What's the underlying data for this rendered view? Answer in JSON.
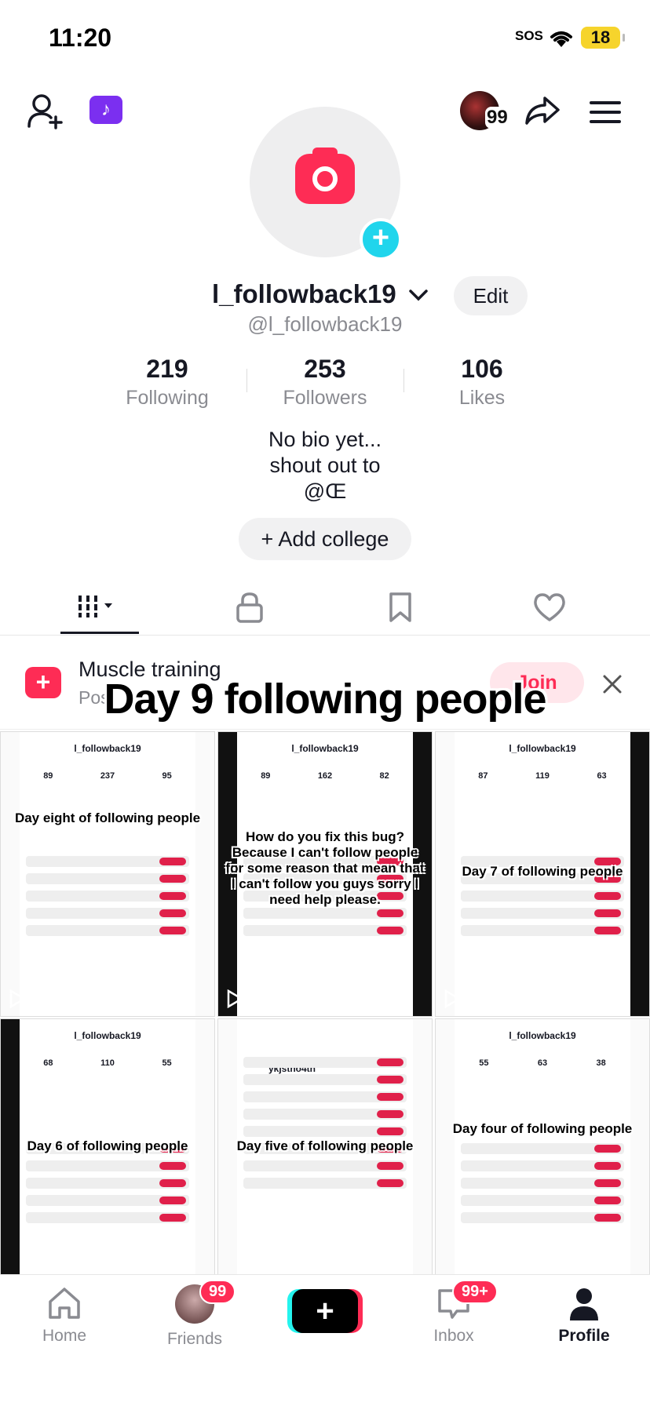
{
  "status": {
    "time": "11:20",
    "sos": "SOS",
    "battery": "18"
  },
  "header": {
    "avatar_count": "99",
    "music_icon": "tiktok-music-icon"
  },
  "profile": {
    "username": "l_followback19",
    "handle": "@l_followback19",
    "edit_label": "Edit",
    "stats": [
      {
        "num": "219",
        "label": "Following"
      },
      {
        "num": "253",
        "label": "Followers"
      },
      {
        "num": "106",
        "label": "Likes"
      }
    ],
    "bio_lines": [
      "No bio yet...",
      "shout out to",
      "@Œ"
    ],
    "add_college_label": "+ Add college"
  },
  "promo": {
    "title": "Muscle training",
    "subtitle": "Pos",
    "subtitle_tail": "s",
    "join_label": "Join",
    "overlay_caption": "Day 9 following people"
  },
  "grid": [
    {
      "caption": "Day eight of following people",
      "name": "l_followback19",
      "stats": [
        "89",
        "237",
        "95"
      ]
    },
    {
      "caption": "How do you fix this bug? Because I can't follow people for some reason that mean that I can't follow you guys sorry I need help please.",
      "name": "l_followback19",
      "stats": [
        "89",
        "162",
        "82"
      ]
    },
    {
      "caption": "Day 7 of following people",
      "name": "l_followback19",
      "stats": [
        "87",
        "119",
        "63"
      ]
    },
    {
      "caption": "Day 6 of following people",
      "name": "l_followback19",
      "stats": [
        "68",
        "110",
        "55"
      ]
    },
    {
      "caption": "Day five of following people",
      "name": "ykjstno4th",
      "stats": [
        "",
        "",
        ""
      ]
    },
    {
      "caption": "Day four of following people",
      "name": "l_followback19",
      "stats": [
        "55",
        "63",
        "38"
      ]
    }
  ],
  "nav": {
    "home": "Home",
    "friends": "Friends",
    "friends_badge": "99",
    "inbox": "Inbox",
    "inbox_badge": "99+",
    "profile": "Profile"
  }
}
